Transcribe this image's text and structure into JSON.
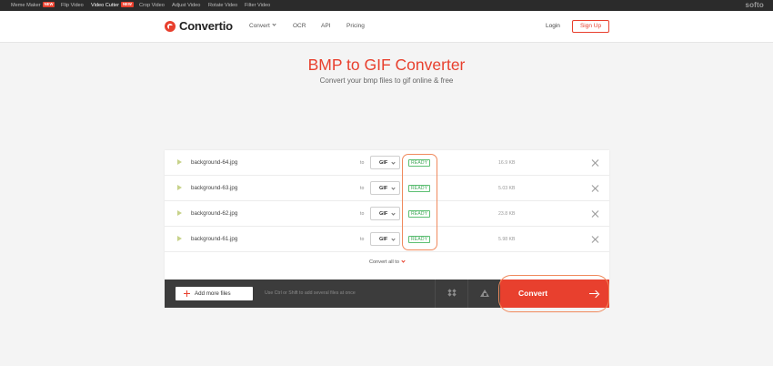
{
  "topbar": {
    "items": [
      {
        "label": "Meme Maker",
        "badge": "NEW"
      },
      {
        "label": "Flip Video",
        "badge": ""
      },
      {
        "label": "Video Cutter",
        "badge": "NEW"
      },
      {
        "label": "Crop Video",
        "badge": ""
      },
      {
        "label": "Adjust Video",
        "badge": ""
      },
      {
        "label": "Rotate Video",
        "badge": ""
      },
      {
        "label": "Filter Video",
        "badge": ""
      }
    ],
    "brand": "softo"
  },
  "header": {
    "logo_text": "Convertio",
    "nav": [
      {
        "label": "Convert"
      },
      {
        "label": "OCR"
      },
      {
        "label": "API"
      },
      {
        "label": "Pricing"
      }
    ],
    "login_label": "Login",
    "signup_label": "Sign Up"
  },
  "hero": {
    "title": "BMP to GIF Converter",
    "subtitle": "Convert your bmp files to gif online & free"
  },
  "files": [
    {
      "name": "background-64.jpg",
      "to": "to",
      "format": "GIF",
      "status": "READY",
      "size": "16.9 KB"
    },
    {
      "name": "background-63.jpg",
      "to": "to",
      "format": "GIF",
      "status": "READY",
      "size": "5.03 KB"
    },
    {
      "name": "background-62.jpg",
      "to": "to",
      "format": "GIF",
      "status": "READY",
      "size": "23.8 KB"
    },
    {
      "name": "background-61.jpg",
      "to": "to",
      "format": "GIF",
      "status": "READY",
      "size": "5.98 KB"
    }
  ],
  "convert_all_label": "Convert all to",
  "bottom": {
    "add_files_label": "Add more files",
    "hint": "Use Ctrl or Shift to add several files at once",
    "convert_label": "Convert"
  },
  "colors": {
    "accent": "#e8402e",
    "ready": "#3fa858",
    "highlight": "#f08a5d"
  }
}
